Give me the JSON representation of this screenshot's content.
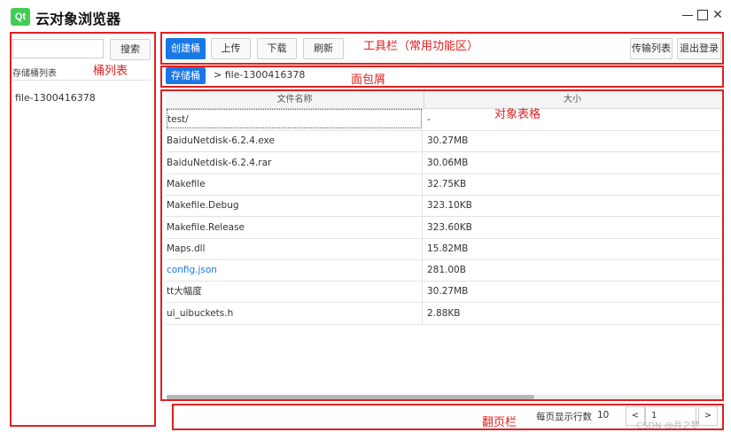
{
  "window": {
    "logo": "Qt",
    "title": "云对象浏览器"
  },
  "annotations": {
    "toolbar_note": "工具栏（常用功能区）",
    "bucket_list_note": "桶列表",
    "breadcrumb_note": "面包屑",
    "object_table_note": "对象表格",
    "pager_note": "翻页栏"
  },
  "sidebar": {
    "search_value": "",
    "search_button": "搜索",
    "list_label": "存储桶列表",
    "buckets": [
      "file-1300416378"
    ]
  },
  "toolbar": {
    "create_bucket": "创建桶",
    "upload": "上传",
    "download": "下载",
    "refresh": "刷新",
    "transfer_list": "传输列表",
    "logout": "退出登录"
  },
  "breadcrumb": {
    "root": "存储桶",
    "path": "> file-1300416378"
  },
  "table": {
    "headers": [
      "文件名称",
      "大小"
    ],
    "rows": [
      {
        "name": "test/",
        "size": "-"
      },
      {
        "name": "BaiduNetdisk-6.2.4.exe",
        "size": "30.27MB"
      },
      {
        "name": "BaiduNetdisk-6.2.4.rar",
        "size": "30.06MB"
      },
      {
        "name": "Makefile",
        "size": "32.75KB"
      },
      {
        "name": "Makefile.Debug",
        "size": "323.10KB"
      },
      {
        "name": "Makefile.Release",
        "size": "323.60KB"
      },
      {
        "name": "Maps.dll",
        "size": "15.82MB"
      },
      {
        "name": "config.json",
        "size": "281.00B"
      },
      {
        "name": "tt大幅度",
        "size": "30.27MB"
      },
      {
        "name": "ui_uibuckets.h",
        "size": "2.88KB"
      }
    ]
  },
  "pager": {
    "rows_label": "每页显示行数",
    "rows_value": "10",
    "prev": "<",
    "page": "1",
    "next": ">"
  },
  "watermark": "CSDN @月之梦"
}
